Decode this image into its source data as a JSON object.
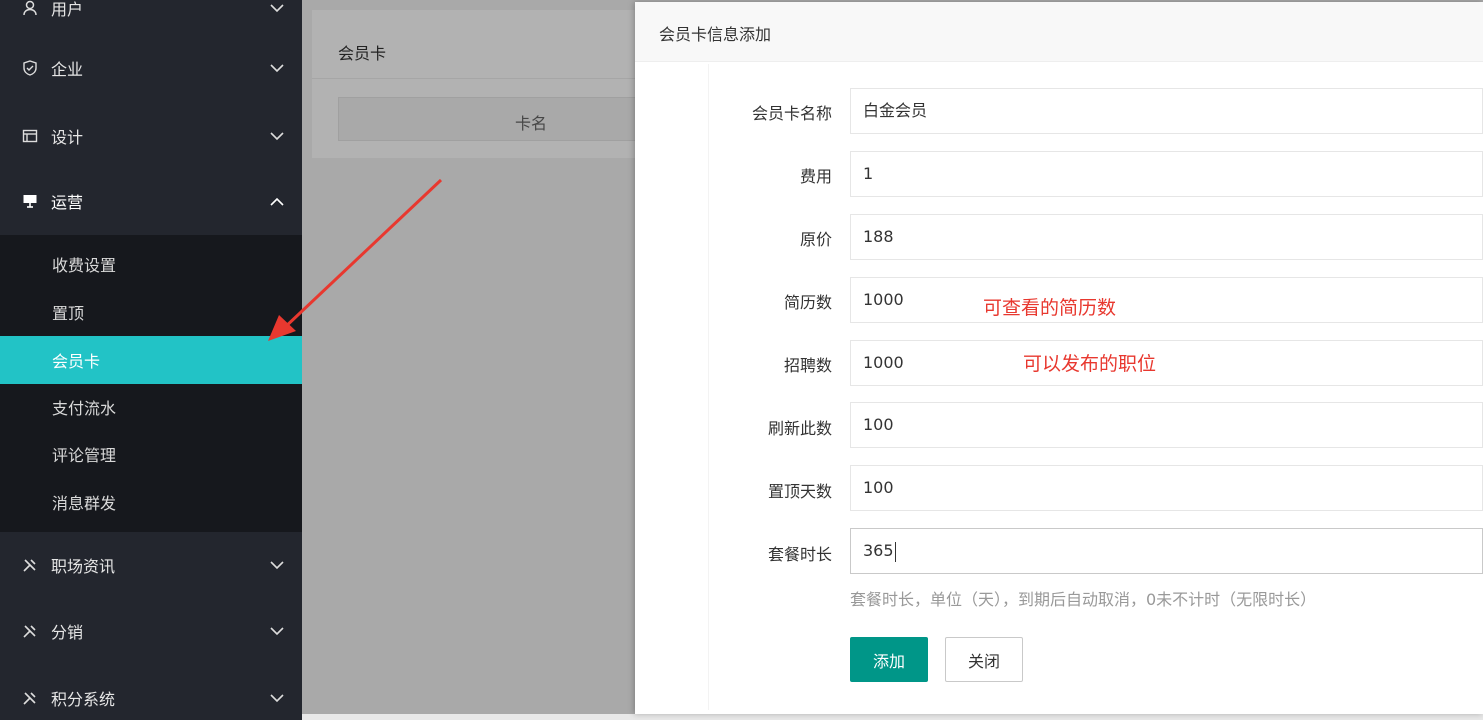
{
  "sidebar": {
    "items": [
      {
        "label": "用户",
        "icon": "user-icon"
      },
      {
        "label": "企业",
        "icon": "shield-icon"
      },
      {
        "label": "设计",
        "icon": "layout-icon"
      },
      {
        "label": "运营",
        "icon": "screen-icon"
      },
      {
        "label": "职场资讯",
        "icon": "tools-icon"
      },
      {
        "label": "分销",
        "icon": "tools-icon"
      },
      {
        "label": "积分系统",
        "icon": "tools-icon"
      }
    ],
    "subitems": [
      {
        "label": "收费设置"
      },
      {
        "label": "置顶"
      },
      {
        "label": "会员卡"
      },
      {
        "label": "支付流水"
      },
      {
        "label": "评论管理"
      },
      {
        "label": "消息群发"
      }
    ],
    "active_color": "#22c3c6"
  },
  "background": {
    "card_title": "会员卡",
    "table_col": "卡名"
  },
  "modal": {
    "title": "会员卡信息添加",
    "fields": [
      {
        "label": "会员卡名称",
        "value": "白金会员"
      },
      {
        "label": "费用",
        "value": "1"
      },
      {
        "label": "原价",
        "value": "188"
      },
      {
        "label": "简历数",
        "value": "1000"
      },
      {
        "label": "招聘数",
        "value": "1000"
      },
      {
        "label": "刷新此数",
        "value": "100"
      },
      {
        "label": "置顶天数",
        "value": "100"
      },
      {
        "label": "套餐时长",
        "value": "365"
      }
    ],
    "hint": "套餐时长，单位（天），到期后自动取消，0未不计时（无限时长）",
    "add_label": "添加",
    "close_label": "关闭",
    "primary_color": "#009688"
  },
  "annotations": {
    "resume": "可查看的简历数",
    "jobs": "可以发布的职位",
    "color": "#e8382f"
  }
}
